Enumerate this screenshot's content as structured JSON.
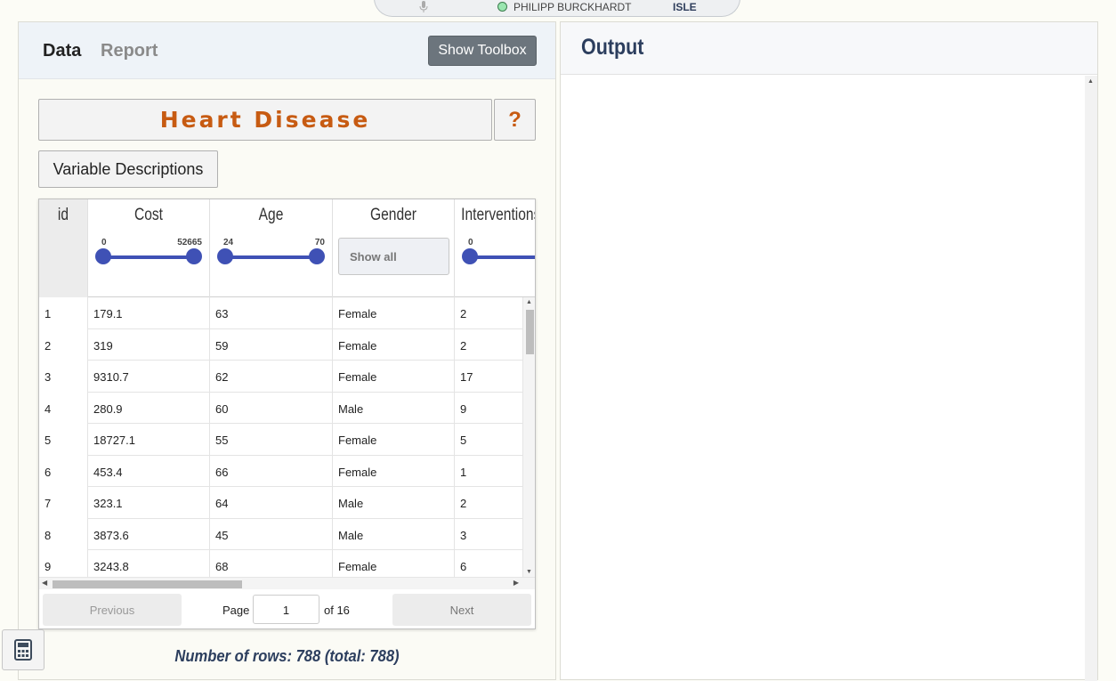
{
  "session": {
    "user": "PHILIPP BURCKHARDT",
    "brand": "ISLE",
    "status_color": "#9ae6b0"
  },
  "tabs": {
    "data": "Data",
    "report": "Report"
  },
  "toolbox_button": "Show Toolbox",
  "dataset": {
    "title": "Heart Disease",
    "help": "?",
    "descriptions_button": "Variable Descriptions"
  },
  "table": {
    "columns": [
      {
        "label": "id"
      },
      {
        "label": "Cost",
        "filter": {
          "type": "range",
          "min": "0",
          "max": "52665"
        }
      },
      {
        "label": "Age",
        "filter": {
          "type": "range",
          "min": "24",
          "max": "70"
        }
      },
      {
        "label": "Gender",
        "filter": {
          "type": "select",
          "value": "Show all"
        }
      },
      {
        "label": "Interventions",
        "filter": {
          "type": "range",
          "min": "0",
          "max": ""
        }
      }
    ],
    "rows": [
      [
        "1",
        "179.1",
        "63",
        "Female",
        "2"
      ],
      [
        "2",
        "319",
        "59",
        "Female",
        "2"
      ],
      [
        "3",
        "9310.7",
        "62",
        "Female",
        "17"
      ],
      [
        "4",
        "280.9",
        "60",
        "Male",
        "9"
      ],
      [
        "5",
        "18727.1",
        "55",
        "Female",
        "5"
      ],
      [
        "6",
        "453.4",
        "66",
        "Female",
        "1"
      ],
      [
        "7",
        "323.1",
        "64",
        "Male",
        "2"
      ],
      [
        "8",
        "3873.6",
        "45",
        "Male",
        "3"
      ],
      [
        "9",
        "3243.8",
        "68",
        "Female",
        "6"
      ]
    ],
    "pager": {
      "previous": "Previous",
      "page_label": "Page",
      "page": "1",
      "of_label": "of 16",
      "next": "Next"
    }
  },
  "row_count": "Number of rows: 788 (total: 788)",
  "output": {
    "title": "Output"
  },
  "icons": {
    "mic": "microphone-icon",
    "calculator": "calculator-icon"
  }
}
